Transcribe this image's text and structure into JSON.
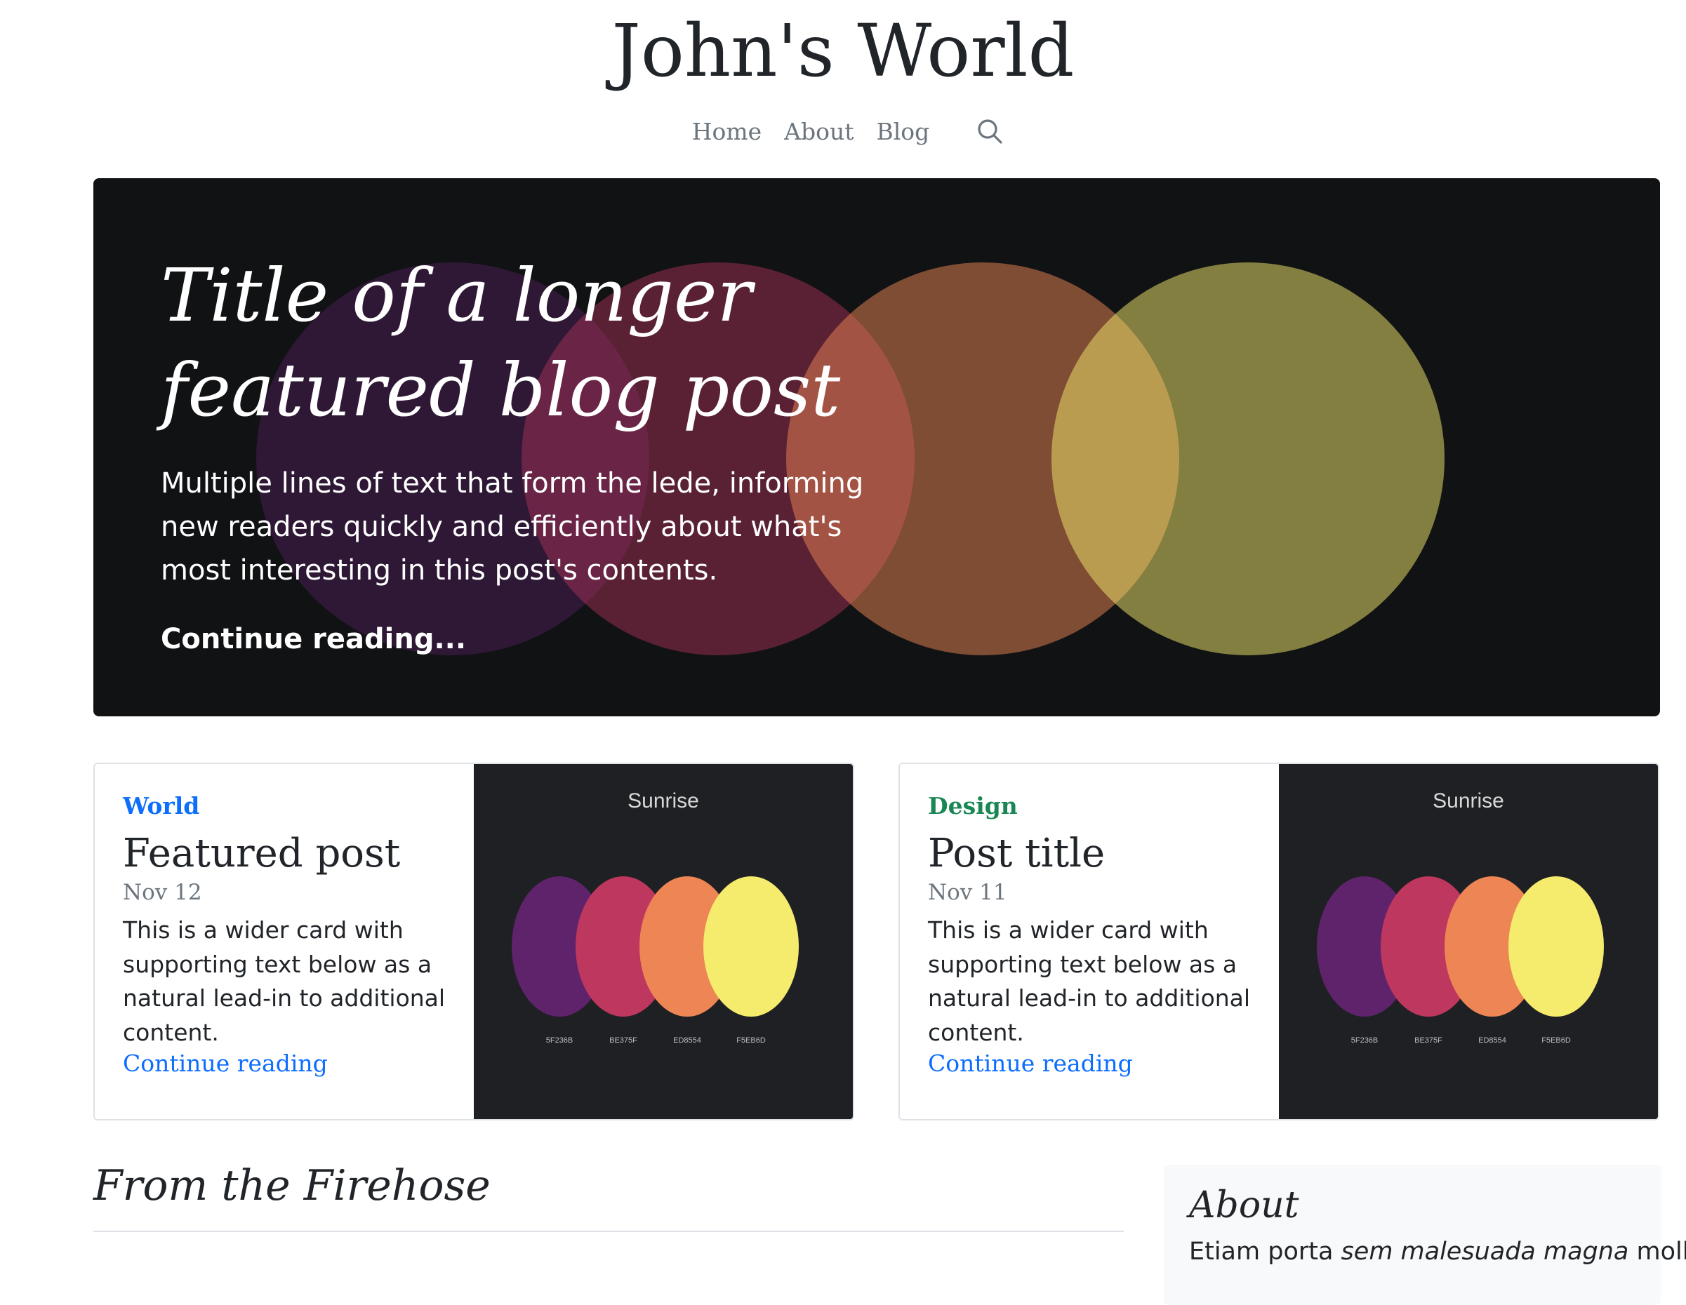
{
  "site": {
    "title": "John's World"
  },
  "nav": {
    "items": [
      "Home",
      "About",
      "Blog"
    ]
  },
  "hero": {
    "title": "Title of a longer featured blog post",
    "lede": "Multiple lines of text that form the lede, informing new readers quickly and efficiently about what's most interesting in this post's contents.",
    "link": "Continue reading..."
  },
  "cards": [
    {
      "category": "World",
      "category_color": "#0d6efd",
      "title": "Featured post",
      "date": "Nov 12",
      "text": "This is a wider card with supporting text below as a natural lead-in to additional content.",
      "link": "Continue reading",
      "thumb": {
        "label": "Sunrise",
        "codes": [
          "5F236B",
          "BE375F",
          "ED8554",
          "F5EB6D"
        ]
      }
    },
    {
      "category": "Design",
      "category_color": "#198754",
      "title": "Post title",
      "date": "Nov 11",
      "text": "This is a wider card with supporting text below as a natural lead-in to additional content.",
      "link": "Continue reading",
      "thumb": {
        "label": "Sunrise",
        "codes": [
          "5F236B",
          "BE375F",
          "ED8554",
          "F5EB6D"
        ]
      }
    }
  ],
  "firehose": {
    "title": "From the Firehose"
  },
  "about": {
    "title": "About",
    "text_start": "Etiam porta ",
    "text_em": "sem malesuada magna",
    "text_end": " mollis"
  },
  "colors": {
    "palette": [
      "#5F236B",
      "#BE375F",
      "#ED8554",
      "#F5EB6D"
    ]
  }
}
